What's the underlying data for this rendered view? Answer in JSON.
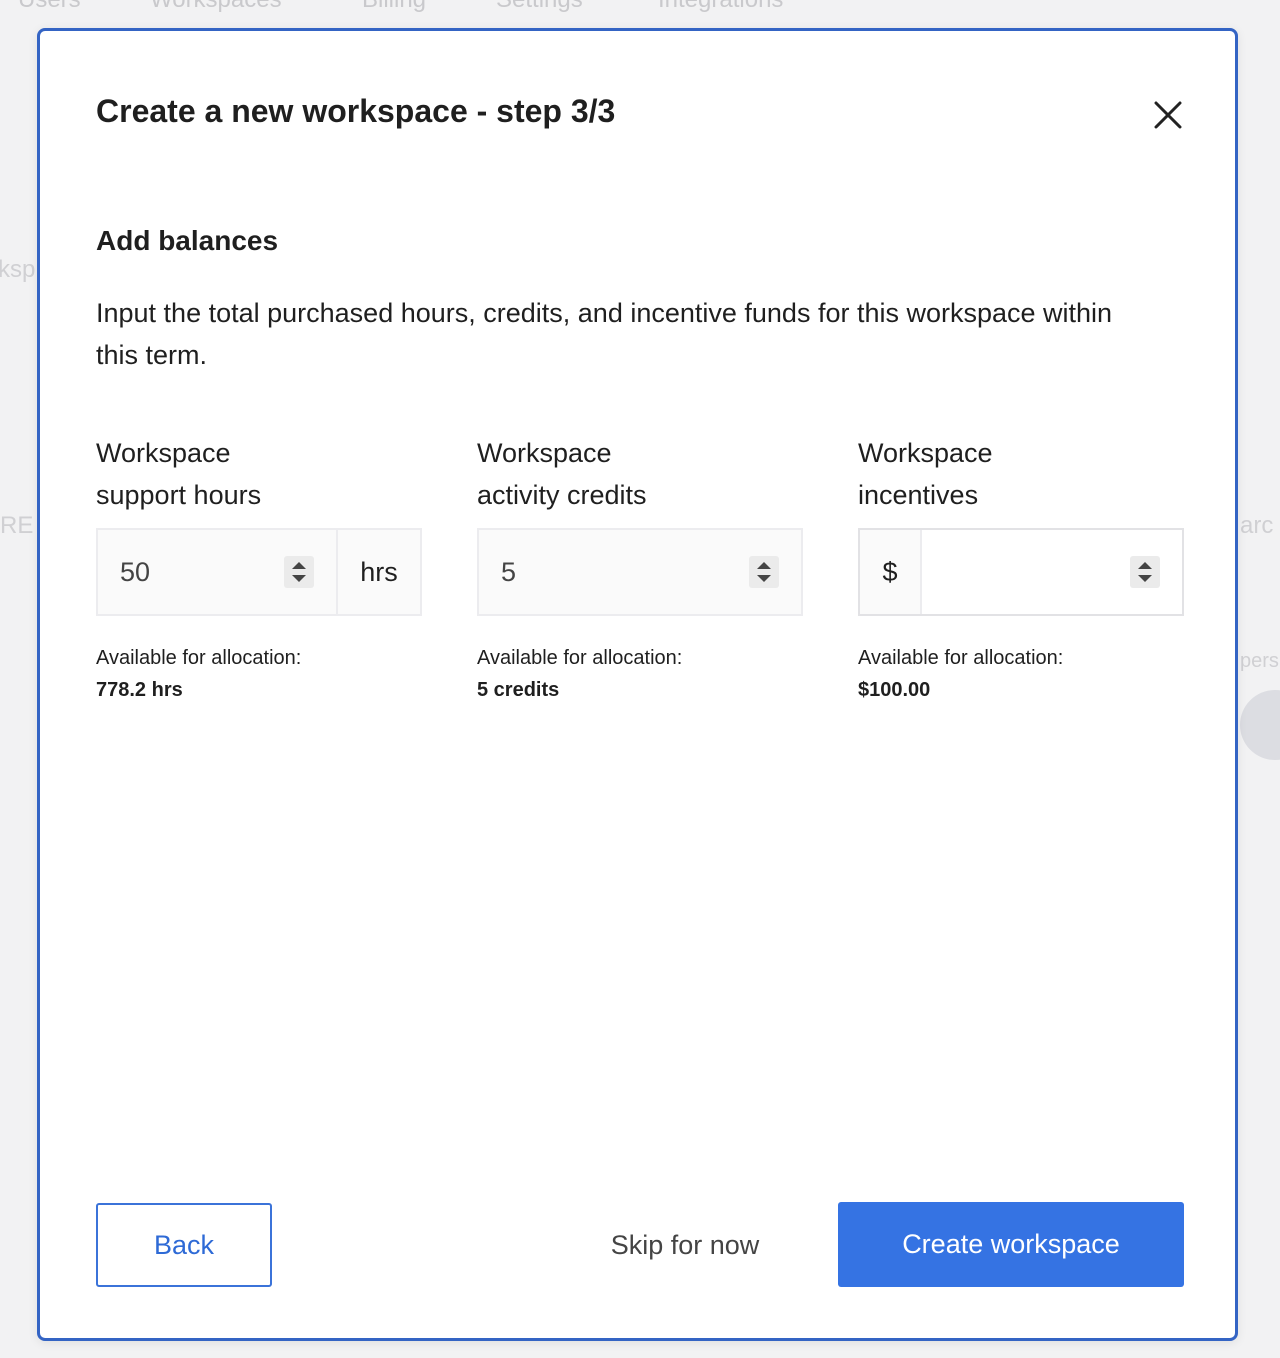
{
  "background": {
    "nav_items": [
      "Users",
      "Workspaces",
      "Billing",
      "Settings",
      "Integrations"
    ],
    "fragments": [
      "ksp",
      "RE",
      "arc",
      "pers"
    ]
  },
  "modal": {
    "title": "Create a new workspace - step 3/3",
    "section_title": "Add balances",
    "description": "Input the total purchased hours, credits, and incentive funds for this workspace within this term.",
    "fields": [
      {
        "label_line1": "Workspace",
        "label_line2": "support hours",
        "value": "50",
        "suffix": "hrs",
        "available_label": "Available for allocation:",
        "available_value": "778.2 hrs"
      },
      {
        "label_line1": "Workspace",
        "label_line2": "activity credits",
        "value": "5",
        "available_label": "Available for allocation:",
        "available_value": "5 credits"
      },
      {
        "label_line1": "Workspace",
        "label_line2": "incentives",
        "prefix": "$",
        "value": "",
        "available_label": "Available for allocation:",
        "available_value": "$100.00"
      }
    ],
    "buttons": {
      "back": "Back",
      "skip": "Skip for now",
      "create": "Create workspace"
    }
  },
  "colors": {
    "accent": "#3573e3",
    "modal_border": "#3464c4",
    "text": "#1f1f1f"
  },
  "icons": {
    "close": "close-icon",
    "spinner": "spinner-arrows-icon"
  }
}
